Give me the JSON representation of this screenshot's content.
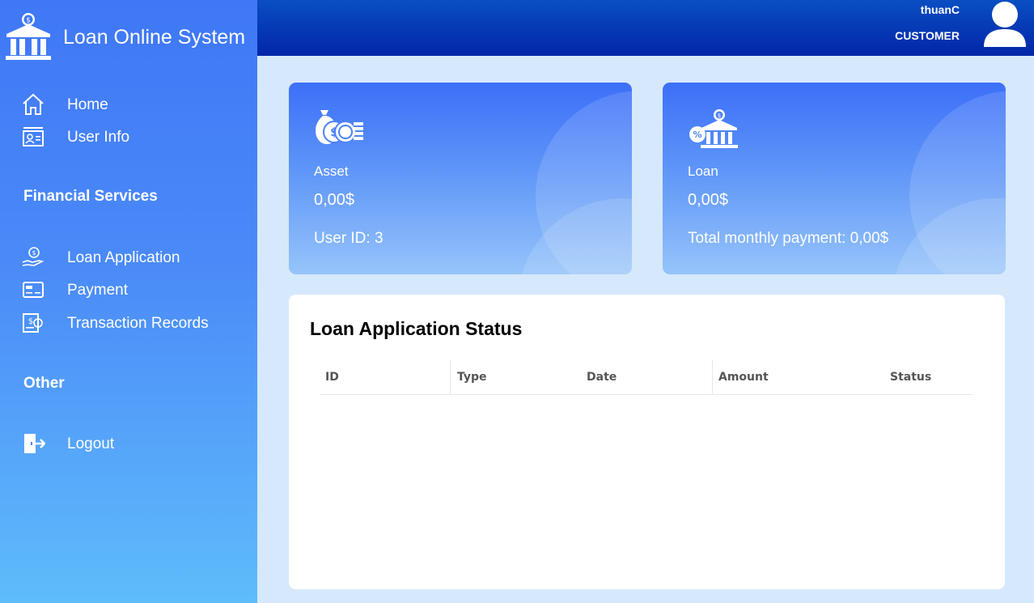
{
  "app": {
    "title": "Loan Online System"
  },
  "header": {
    "username": "thuanC",
    "role": "CUSTOMER"
  },
  "sidebar": {
    "top_items": [
      {
        "label": "Home",
        "icon": "home-icon"
      },
      {
        "label": "User Info",
        "icon": "user-card-icon"
      }
    ],
    "financial_title": "Financial Services",
    "financial_items": [
      {
        "label": "Loan Application",
        "icon": "hand-coin-icon"
      },
      {
        "label": "Payment",
        "icon": "payment-card-icon"
      },
      {
        "label": "Transaction Records",
        "icon": "receipt-icon"
      }
    ],
    "other_title": "Other",
    "other_items": [
      {
        "label": "Logout",
        "icon": "logout-door-icon"
      }
    ]
  },
  "cards": {
    "asset": {
      "label": "Asset",
      "value": "0,00$",
      "extra": "User ID: 3",
      "icon": "money-bag-coins-icon"
    },
    "loan": {
      "label": "Loan",
      "value": "0,00$",
      "extra": "Total monthly payment: 0,00$",
      "icon": "bank-percent-icon"
    }
  },
  "status_panel": {
    "title": "Loan Application Status",
    "columns": [
      "ID",
      "Type",
      "Date",
      "Amount",
      "Status"
    ],
    "rows": []
  },
  "colors": {
    "sidebar_top": "#3f77f6",
    "sidebar_bottom": "#5fbcfb",
    "header": "#0226a8",
    "background": "#d6e8fb"
  }
}
